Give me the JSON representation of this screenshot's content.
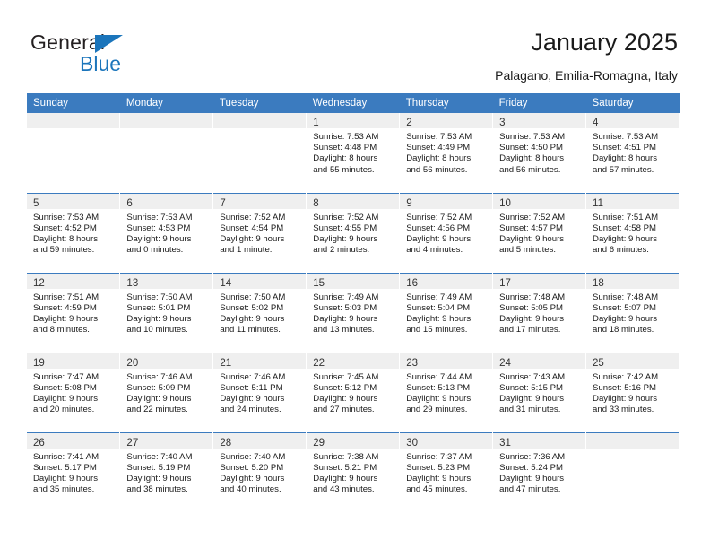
{
  "brand": {
    "name_part1": "General",
    "name_part2": "Blue",
    "color_primary": "#1b75bb",
    "color_text": "#231f20"
  },
  "header": {
    "title": "January 2025",
    "subtitle": "Palagano, Emilia-Romagna, Italy"
  },
  "theme": {
    "header_row_bg": "#3b7bbf",
    "header_row_text": "#ffffff",
    "daynum_band_bg": "#efefef",
    "row_divider": "#3b7bbf"
  },
  "weekdays": [
    "Sunday",
    "Monday",
    "Tuesday",
    "Wednesday",
    "Thursday",
    "Friday",
    "Saturday"
  ],
  "labels": {
    "sunrise_prefix": "Sunrise:",
    "sunset_prefix": "Sunset:",
    "daylight_prefix": "Daylight:"
  },
  "weeks": [
    [
      {
        "day": "",
        "empty": true
      },
      {
        "day": "",
        "empty": true
      },
      {
        "day": "",
        "empty": true
      },
      {
        "day": "1",
        "sunrise": "Sunrise: 7:53 AM",
        "sunset": "Sunset: 4:48 PM",
        "daylight1": "Daylight: 8 hours",
        "daylight2": "and 55 minutes."
      },
      {
        "day": "2",
        "sunrise": "Sunrise: 7:53 AM",
        "sunset": "Sunset: 4:49 PM",
        "daylight1": "Daylight: 8 hours",
        "daylight2": "and 56 minutes."
      },
      {
        "day": "3",
        "sunrise": "Sunrise: 7:53 AM",
        "sunset": "Sunset: 4:50 PM",
        "daylight1": "Daylight: 8 hours",
        "daylight2": "and 56 minutes."
      },
      {
        "day": "4",
        "sunrise": "Sunrise: 7:53 AM",
        "sunset": "Sunset: 4:51 PM",
        "daylight1": "Daylight: 8 hours",
        "daylight2": "and 57 minutes."
      }
    ],
    [
      {
        "day": "5",
        "sunrise": "Sunrise: 7:53 AM",
        "sunset": "Sunset: 4:52 PM",
        "daylight1": "Daylight: 8 hours",
        "daylight2": "and 59 minutes."
      },
      {
        "day": "6",
        "sunrise": "Sunrise: 7:53 AM",
        "sunset": "Sunset: 4:53 PM",
        "daylight1": "Daylight: 9 hours",
        "daylight2": "and 0 minutes."
      },
      {
        "day": "7",
        "sunrise": "Sunrise: 7:52 AM",
        "sunset": "Sunset: 4:54 PM",
        "daylight1": "Daylight: 9 hours",
        "daylight2": "and 1 minute."
      },
      {
        "day": "8",
        "sunrise": "Sunrise: 7:52 AM",
        "sunset": "Sunset: 4:55 PM",
        "daylight1": "Daylight: 9 hours",
        "daylight2": "and 2 minutes."
      },
      {
        "day": "9",
        "sunrise": "Sunrise: 7:52 AM",
        "sunset": "Sunset: 4:56 PM",
        "daylight1": "Daylight: 9 hours",
        "daylight2": "and 4 minutes."
      },
      {
        "day": "10",
        "sunrise": "Sunrise: 7:52 AM",
        "sunset": "Sunset: 4:57 PM",
        "daylight1": "Daylight: 9 hours",
        "daylight2": "and 5 minutes."
      },
      {
        "day": "11",
        "sunrise": "Sunrise: 7:51 AM",
        "sunset": "Sunset: 4:58 PM",
        "daylight1": "Daylight: 9 hours",
        "daylight2": "and 6 minutes."
      }
    ],
    [
      {
        "day": "12",
        "sunrise": "Sunrise: 7:51 AM",
        "sunset": "Sunset: 4:59 PM",
        "daylight1": "Daylight: 9 hours",
        "daylight2": "and 8 minutes."
      },
      {
        "day": "13",
        "sunrise": "Sunrise: 7:50 AM",
        "sunset": "Sunset: 5:01 PM",
        "daylight1": "Daylight: 9 hours",
        "daylight2": "and 10 minutes."
      },
      {
        "day": "14",
        "sunrise": "Sunrise: 7:50 AM",
        "sunset": "Sunset: 5:02 PM",
        "daylight1": "Daylight: 9 hours",
        "daylight2": "and 11 minutes."
      },
      {
        "day": "15",
        "sunrise": "Sunrise: 7:49 AM",
        "sunset": "Sunset: 5:03 PM",
        "daylight1": "Daylight: 9 hours",
        "daylight2": "and 13 minutes."
      },
      {
        "day": "16",
        "sunrise": "Sunrise: 7:49 AM",
        "sunset": "Sunset: 5:04 PM",
        "daylight1": "Daylight: 9 hours",
        "daylight2": "and 15 minutes."
      },
      {
        "day": "17",
        "sunrise": "Sunrise: 7:48 AM",
        "sunset": "Sunset: 5:05 PM",
        "daylight1": "Daylight: 9 hours",
        "daylight2": "and 17 minutes."
      },
      {
        "day": "18",
        "sunrise": "Sunrise: 7:48 AM",
        "sunset": "Sunset: 5:07 PM",
        "daylight1": "Daylight: 9 hours",
        "daylight2": "and 18 minutes."
      }
    ],
    [
      {
        "day": "19",
        "sunrise": "Sunrise: 7:47 AM",
        "sunset": "Sunset: 5:08 PM",
        "daylight1": "Daylight: 9 hours",
        "daylight2": "and 20 minutes."
      },
      {
        "day": "20",
        "sunrise": "Sunrise: 7:46 AM",
        "sunset": "Sunset: 5:09 PM",
        "daylight1": "Daylight: 9 hours",
        "daylight2": "and 22 minutes."
      },
      {
        "day": "21",
        "sunrise": "Sunrise: 7:46 AM",
        "sunset": "Sunset: 5:11 PM",
        "daylight1": "Daylight: 9 hours",
        "daylight2": "and 24 minutes."
      },
      {
        "day": "22",
        "sunrise": "Sunrise: 7:45 AM",
        "sunset": "Sunset: 5:12 PM",
        "daylight1": "Daylight: 9 hours",
        "daylight2": "and 27 minutes."
      },
      {
        "day": "23",
        "sunrise": "Sunrise: 7:44 AM",
        "sunset": "Sunset: 5:13 PM",
        "daylight1": "Daylight: 9 hours",
        "daylight2": "and 29 minutes."
      },
      {
        "day": "24",
        "sunrise": "Sunrise: 7:43 AM",
        "sunset": "Sunset: 5:15 PM",
        "daylight1": "Daylight: 9 hours",
        "daylight2": "and 31 minutes."
      },
      {
        "day": "25",
        "sunrise": "Sunrise: 7:42 AM",
        "sunset": "Sunset: 5:16 PM",
        "daylight1": "Daylight: 9 hours",
        "daylight2": "and 33 minutes."
      }
    ],
    [
      {
        "day": "26",
        "sunrise": "Sunrise: 7:41 AM",
        "sunset": "Sunset: 5:17 PM",
        "daylight1": "Daylight: 9 hours",
        "daylight2": "and 35 minutes."
      },
      {
        "day": "27",
        "sunrise": "Sunrise: 7:40 AM",
        "sunset": "Sunset: 5:19 PM",
        "daylight1": "Daylight: 9 hours",
        "daylight2": "and 38 minutes."
      },
      {
        "day": "28",
        "sunrise": "Sunrise: 7:40 AM",
        "sunset": "Sunset: 5:20 PM",
        "daylight1": "Daylight: 9 hours",
        "daylight2": "and 40 minutes."
      },
      {
        "day": "29",
        "sunrise": "Sunrise: 7:38 AM",
        "sunset": "Sunset: 5:21 PM",
        "daylight1": "Daylight: 9 hours",
        "daylight2": "and 43 minutes."
      },
      {
        "day": "30",
        "sunrise": "Sunrise: 7:37 AM",
        "sunset": "Sunset: 5:23 PM",
        "daylight1": "Daylight: 9 hours",
        "daylight2": "and 45 minutes."
      },
      {
        "day": "31",
        "sunrise": "Sunrise: 7:36 AM",
        "sunset": "Sunset: 5:24 PM",
        "daylight1": "Daylight: 9 hours",
        "daylight2": "and 47 minutes."
      },
      {
        "day": "",
        "empty": true
      }
    ]
  ]
}
